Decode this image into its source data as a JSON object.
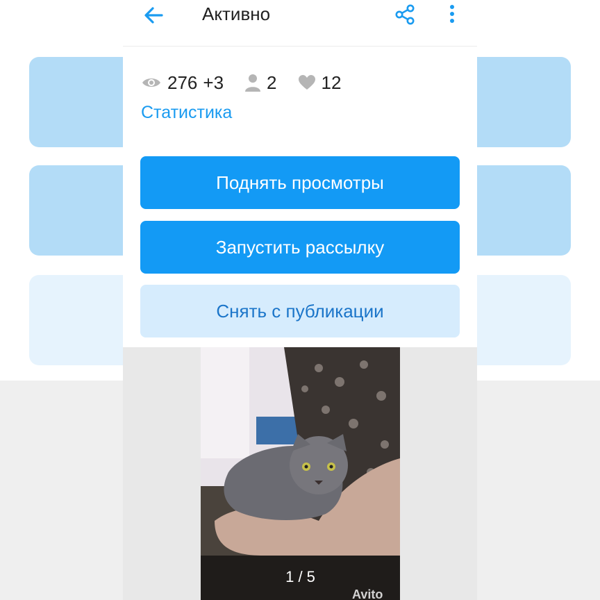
{
  "header": {
    "title": "Активно",
    "back_icon": "arrow-left-icon",
    "share_icon": "share-icon",
    "more_icon": "more-vertical-icon"
  },
  "stats": {
    "views": "276",
    "views_delta": "+3",
    "contacts": "2",
    "favorites": "12",
    "link_label": "Статистика"
  },
  "actions": {
    "raise_views": "Поднять просмотры",
    "start_mailing": "Запустить рассылку",
    "unpublish": "Снять с публикации"
  },
  "gallery": {
    "counter": "1 / 5",
    "watermark": "Avito"
  },
  "colors": {
    "accent": "#139af5",
    "link": "#1a9bf0",
    "secondary_bg": "#d6ecfd",
    "secondary_text": "#1b75c9"
  }
}
